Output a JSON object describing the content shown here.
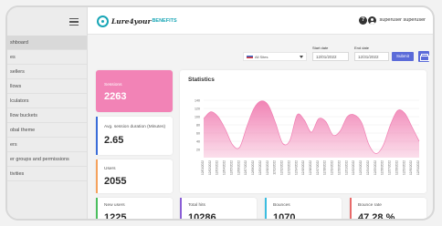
{
  "sidebar": {
    "items": [
      {
        "label": "shboard",
        "active": true
      },
      {
        "label": "es"
      },
      {
        "label": "sellers"
      },
      {
        "label": "llows"
      },
      {
        "label": "lculators"
      },
      {
        "label": "llow buckets"
      },
      {
        "label": "obal theme"
      },
      {
        "label": "ers"
      },
      {
        "label": "er groups and permissions"
      },
      {
        "label": "tivities"
      }
    ]
  },
  "header": {
    "brand": "Lure4your",
    "brand_suffix": "BENEFITS",
    "user": "superuser superuser"
  },
  "filters": {
    "site": "All Sites",
    "start_label": "Start date",
    "start_value": "12/01/2022",
    "end_label": "End date",
    "end_value": "12/31/2022",
    "submit": "Submit"
  },
  "metrics": {
    "sessions_label": "Sessions",
    "sessions_value": "2263",
    "avg_label": "Avg. session duration (Minutes)",
    "avg_value": "2.65",
    "users_label": "Users",
    "users_value": "2055",
    "new_users_label": "New users",
    "new_users_value": "1225",
    "total_hits_label": "Total hits",
    "total_hits_value": "10286",
    "bounces_label": "Bounces",
    "bounces_value": "1070",
    "bounce_rate_label": "Bounce rate",
    "bounce_rate_value": "47.28 %"
  },
  "colors": {
    "sessions_card": "#f283b6",
    "chart_fill": "#f07db1",
    "accent_blue": "#3b6dd9",
    "accent_orange": "#f5a25d",
    "accent_green": "#4bbf5e",
    "accent_purple": "#8a5ed6",
    "accent_cyan": "#3bbde0",
    "accent_red": "#e86a6a",
    "button": "#5b6bd9"
  },
  "statistics": {
    "title": "Statistics"
  },
  "chart_data": {
    "type": "area",
    "title": "Statistics",
    "ylim": [
      0,
      160
    ],
    "yticks": [
      20,
      40,
      60,
      80,
      100,
      120,
      140
    ],
    "x": [
      "12/01/2022",
      "12/02/2022",
      "12/03/2022",
      "12/04/2022",
      "12/05/2022",
      "12/06/2022",
      "12/07/2022",
      "12/08/2022",
      "12/09/2022",
      "12/10/2022",
      "12/11/2022",
      "12/12/2022",
      "12/13/2022",
      "12/14/2022",
      "12/15/2022",
      "12/16/2022",
      "12/17/2022",
      "12/18/2022",
      "12/19/2022",
      "12/20/2022",
      "12/21/2022",
      "12/22/2022",
      "12/23/2022",
      "12/24/2022",
      "12/25/2022",
      "12/26/2022",
      "12/27/2022",
      "12/28/2022",
      "12/29/2022",
      "12/30/2022",
      "12/31/2022"
    ],
    "series": [
      {
        "values": [
          95,
          112,
          100,
          70,
          32,
          25,
          75,
          120,
          138,
          128,
          85,
          35,
          42,
          104,
          92,
          62,
          95,
          88,
          55,
          65,
          100,
          104,
          85,
          32,
          10,
          30,
          80,
          115,
          108,
          75,
          40
        ]
      }
    ],
    "grid": true
  }
}
